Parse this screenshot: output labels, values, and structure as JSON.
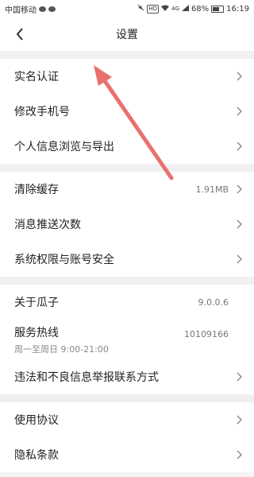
{
  "status_bar": {
    "carrier": "中国移动",
    "battery": "68%",
    "time": "16:19",
    "signal_label": "4G",
    "hd_label": "HD"
  },
  "header": {
    "title": "设置"
  },
  "groups": [
    {
      "items": [
        {
          "label": "实名认证"
        },
        {
          "label": "修改手机号"
        },
        {
          "label": "个人信息浏览与导出"
        }
      ]
    },
    {
      "items": [
        {
          "label": "清除缓存",
          "value": "1.91MB"
        },
        {
          "label": "消息推送次数"
        },
        {
          "label": "系统权限与账号安全"
        }
      ]
    },
    {
      "items": [
        {
          "label": "关于瓜子",
          "value": "9.0.0.6"
        },
        {
          "label": "服务热线",
          "value": "10109166",
          "sub": "周一至周日 9:00-21:00"
        },
        {
          "label": "违法和不良信息举报联系方式"
        }
      ]
    },
    {
      "items": [
        {
          "label": "使用协议"
        },
        {
          "label": "隐私条款"
        }
      ]
    }
  ],
  "colors": {
    "annotation_arrow": "#e8706e"
  }
}
